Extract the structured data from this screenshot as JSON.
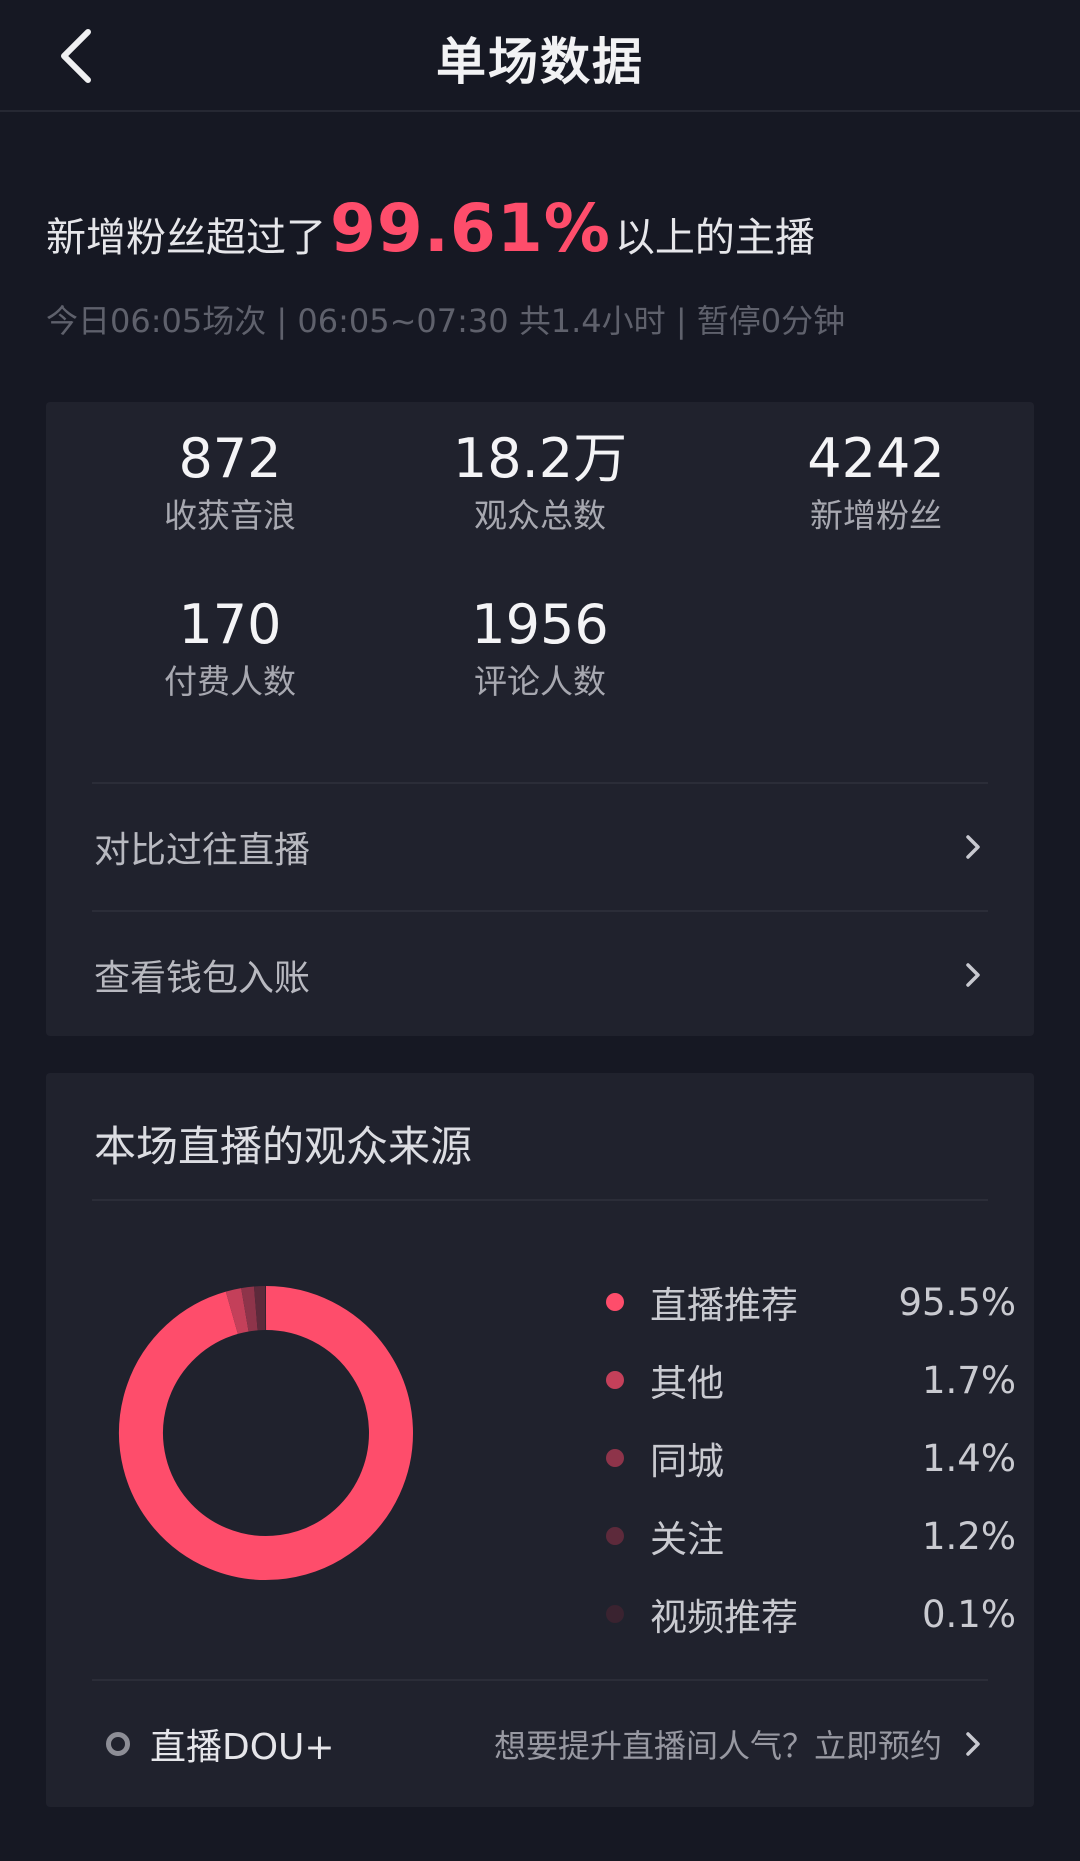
{
  "header": {
    "title": "单场数据",
    "back_icon": "chevron-left-icon"
  },
  "summary": {
    "headline_prefix": "新增粉丝超过了",
    "headline_percent": "99.61%",
    "headline_suffix": "以上的主播",
    "session_meta": "今日06:05场次 | 06:05~07:30 共1.4小时 | 暂停0分钟"
  },
  "stats": [
    {
      "value": "872",
      "label": "收获音浪"
    },
    {
      "value": "18.2万",
      "label": "观众总数"
    },
    {
      "value": "4242",
      "label": "新增粉丝"
    },
    {
      "value": "170",
      "label": "付费人数"
    },
    {
      "value": "1956",
      "label": "评论人数"
    }
  ],
  "links": {
    "compare_past": "对比过往直播",
    "wallet": "查看钱包入账"
  },
  "audience_source": {
    "title": "本场直播的观众来源",
    "legend": [
      {
        "name": "直播推荐",
        "percent": "95.5%",
        "value": 95.5,
        "color": "#fe4d6b"
      },
      {
        "name": "其他",
        "percent": "1.7%",
        "value": 1.7,
        "color": "#c4405a"
      },
      {
        "name": "同城",
        "percent": "1.4%",
        "value": 1.4,
        "color": "#8e344a"
      },
      {
        "name": "关注",
        "percent": "1.2%",
        "value": 1.2,
        "color": "#5d2a3b"
      },
      {
        "name": "视频推荐",
        "percent": "0.1%",
        "value": 0.1,
        "color": "#3a2330"
      }
    ]
  },
  "dou": {
    "label": "直播DOU+",
    "promo": "想要提升直播间人气？立即预约"
  },
  "colors": {
    "accent": "#fe4d6b",
    "background": "#161823",
    "card": "#20222d"
  }
}
